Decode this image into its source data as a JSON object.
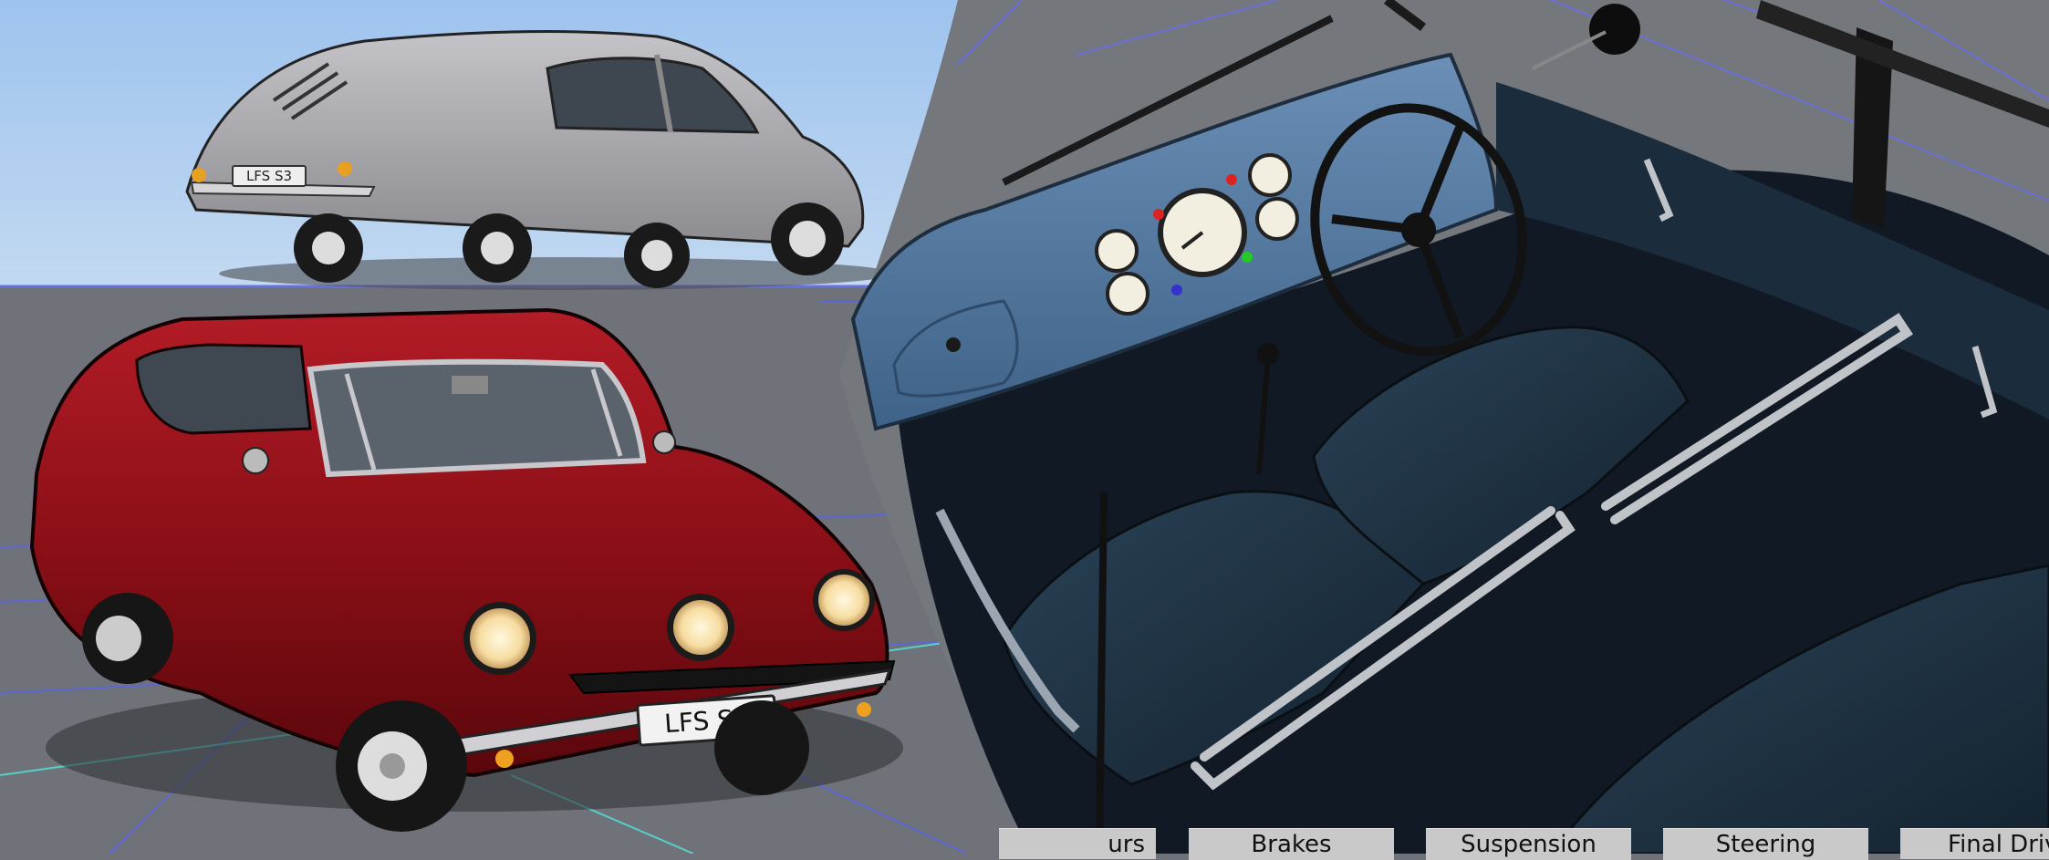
{
  "scene": {
    "plate_text_front": "LFS S3",
    "plate_text_rear": "LFS S3",
    "colors": {
      "sky": "#a9c9ee",
      "ground": "#6f7379",
      "grid_line": "#5860d8",
      "grid_accent": "#55d0c8",
      "car_red": "#8c0f17",
      "car_silver": "#a6a6ab",
      "interior_blue": "#5b7fa6",
      "seat_navy": "#1e3142"
    }
  },
  "tabs": [
    {
      "label": "urs"
    },
    {
      "label": "Brakes"
    },
    {
      "label": "Suspension"
    },
    {
      "label": "Steering"
    },
    {
      "label": "Final Driv"
    }
  ]
}
